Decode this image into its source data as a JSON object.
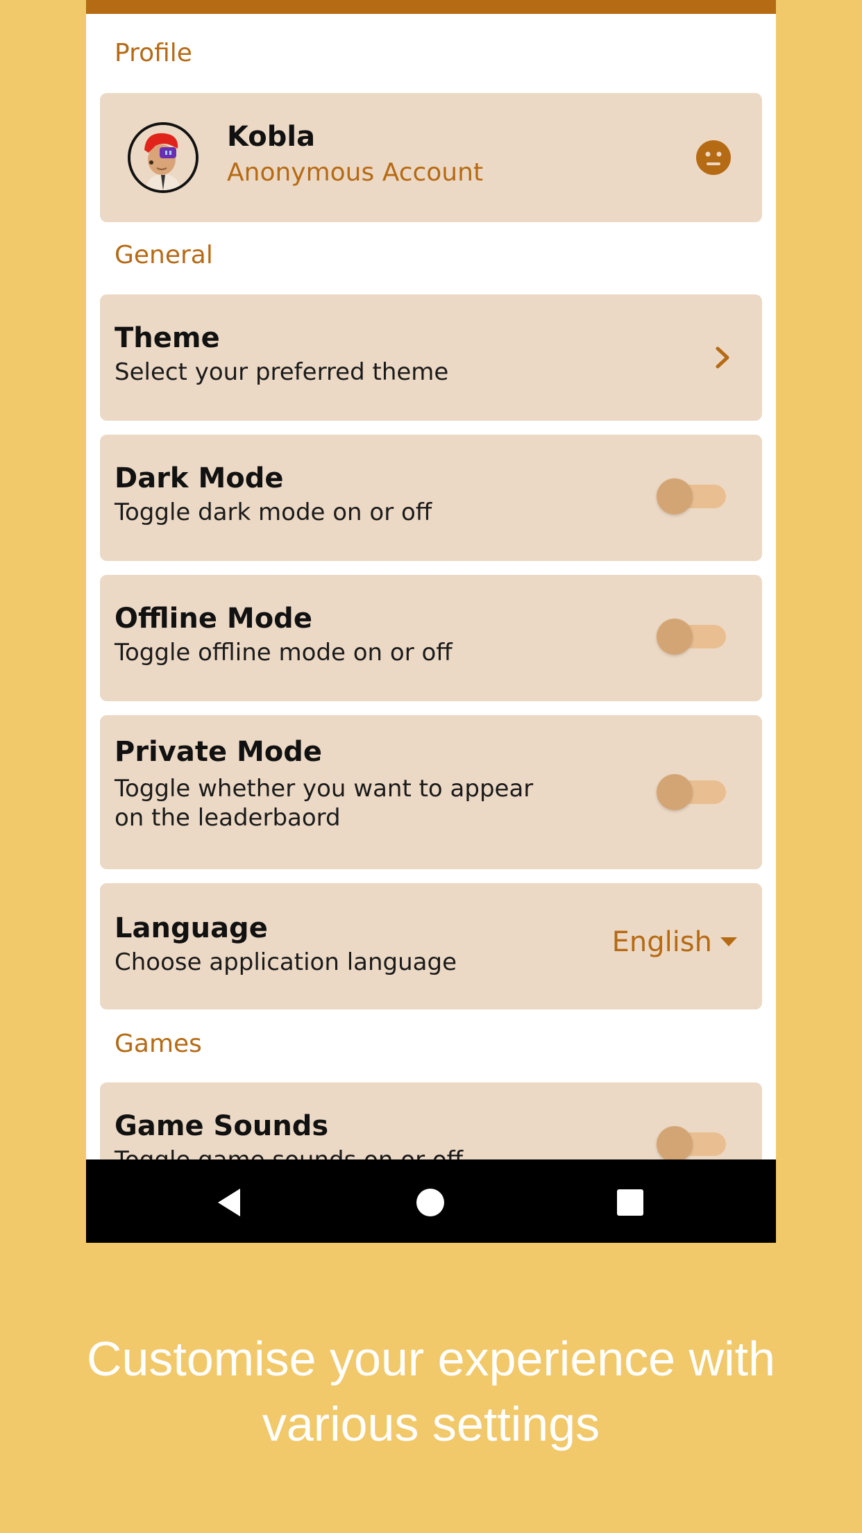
{
  "sections": {
    "profile": "Profile",
    "general": "General",
    "games": "Games"
  },
  "profile": {
    "name": "Kobla",
    "account": "Anonymous Account",
    "status_icon": "neutral-face-icon"
  },
  "settings": {
    "theme": {
      "title": "Theme",
      "subtitle": "Select your preferred theme"
    },
    "dark_mode": {
      "title": "Dark Mode",
      "subtitle": "Toggle dark mode on or off",
      "enabled": false
    },
    "offline_mode": {
      "title": "Offline Mode",
      "subtitle": "Toggle offline mode on or off",
      "enabled": false
    },
    "private_mode": {
      "title": "Private Mode",
      "subtitle_line1": "Toggle whether you want to appear",
      "subtitle_line2": "on the leaderbaord",
      "enabled": false
    },
    "language": {
      "title": "Language",
      "subtitle": "Choose application language",
      "selected": "English"
    },
    "game_sounds": {
      "title": "Game Sounds",
      "subtitle": "Toggle game sounds on or off",
      "enabled": false
    }
  },
  "caption": {
    "line1": "Customise your experience with",
    "line2": "various settings"
  },
  "colors": {
    "background": "#F1C96A",
    "accent": "#B56A14",
    "card": "#ECD9C5",
    "toggle_track": "#E9BF92",
    "toggle_thumb": "#D4A574"
  }
}
